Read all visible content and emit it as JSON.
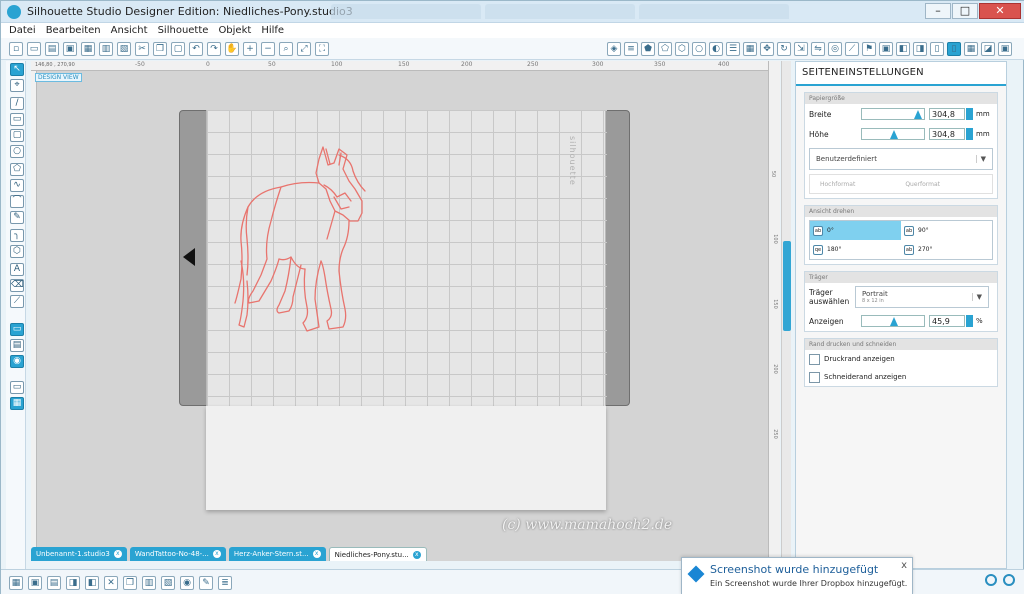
{
  "window": {
    "title": "Silhouette Studio Designer Edition: Niedliches-Pony.studio3"
  },
  "menu": [
    "Datei",
    "Bearbeiten",
    "Ansicht",
    "Silhouette",
    "Objekt",
    "Hilfe"
  ],
  "canvas": {
    "design_view": "DESIGN VIEW",
    "coords": "146,80 , 270,90",
    "ruler_top": [
      "-50",
      "0",
      "50",
      "100",
      "150",
      "200",
      "250",
      "300",
      "350",
      "400"
    ],
    "ruler_right": [
      "50",
      "100",
      "150",
      "200",
      "250"
    ],
    "mat_brand": "silhouette",
    "watermark": "(c) www.mamahoch2.de"
  },
  "panel": {
    "title": "SEITENEINSTELLUNGEN",
    "papier": {
      "header": "Papiergröße",
      "breite_label": "Breite",
      "breite_value": "304,8",
      "hoehe_label": "Höhe",
      "hoehe_value": "304,8",
      "unit": "mm",
      "size_select": "Benutzerdefiniert",
      "hochformat": "Hochformat",
      "querformat": "Querformat"
    },
    "drehen": {
      "header": "Ansicht drehen",
      "options": [
        "0°",
        "90°",
        "180°",
        "270°"
      ]
    },
    "traeger": {
      "header": "Träger",
      "select_label": "Träger auswählen",
      "select_value": "Portrait",
      "select_sub": "8 x 12 in",
      "anzeigen_label": "Anzeigen",
      "anzeigen_value": "45,9",
      "unit": "%"
    },
    "rand": {
      "header": "Rand drucken und schneiden",
      "druckrand": "Druckrand anzeigen",
      "schneiderand": "Schneiderand anzeigen"
    }
  },
  "doc_tabs": [
    "Unbenannt-1.studio3",
    "WandTattoo-No-48-...",
    "Herz-Anker-Stern.st...",
    "Niedliches-Pony.stu..."
  ],
  "notification": {
    "title": "Screenshot wurde hinzugefügt",
    "body": "Ein Screenshot wurde Ihrer Dropbox hinzugefügt.",
    "close": "x"
  },
  "colors": {
    "accent": "#2aa3d2",
    "horse_stroke": "#e8746e"
  }
}
